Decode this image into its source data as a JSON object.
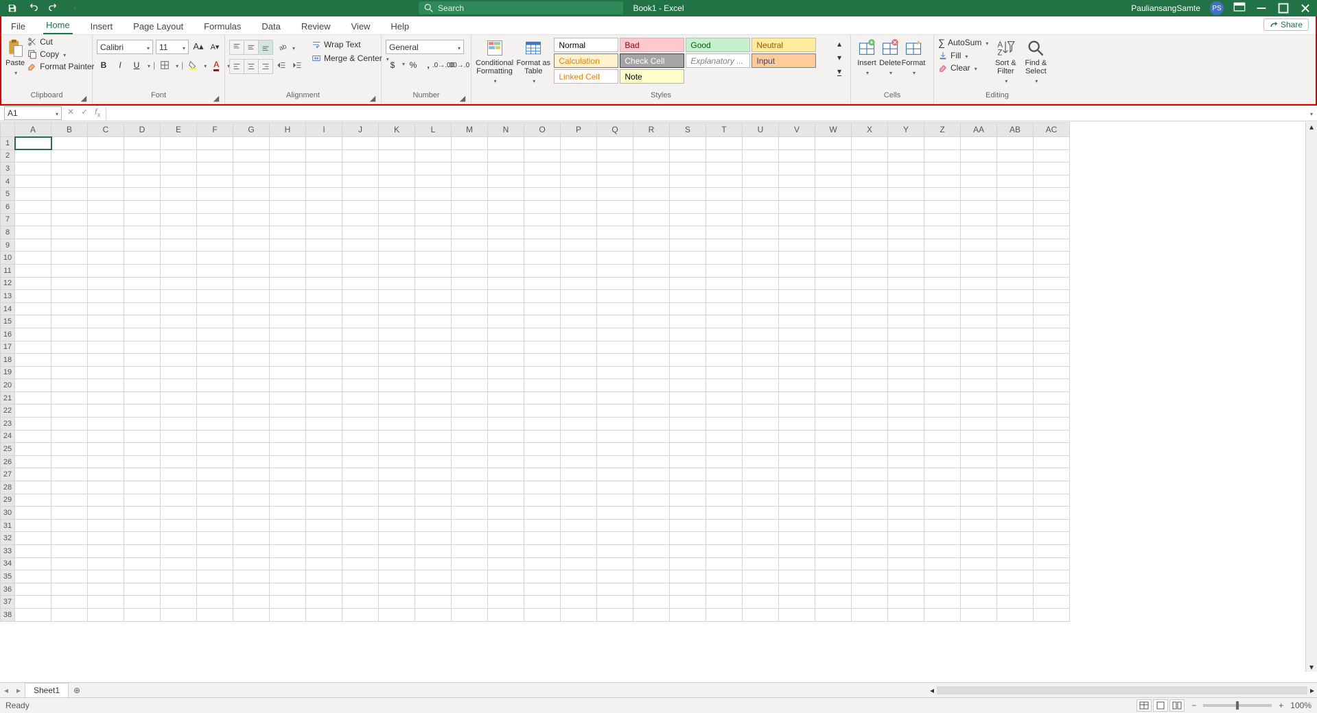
{
  "title_bar": {
    "doc_title": "Book1  -  Excel",
    "search_placeholder": "Search",
    "username": "PauliansangSamte",
    "avatar_initials": "PS"
  },
  "tabs": {
    "file": "File",
    "home": "Home",
    "insert": "Insert",
    "page_layout": "Page Layout",
    "formulas": "Formulas",
    "data": "Data",
    "review": "Review",
    "view": "View",
    "help": "Help",
    "share": "Share"
  },
  "ribbon": {
    "clipboard": {
      "paste": "Paste",
      "cut": "Cut",
      "copy": "Copy",
      "format_painter": "Format Painter",
      "label": "Clipboard"
    },
    "font": {
      "name": "Calibri",
      "size": "11",
      "label": "Font"
    },
    "alignment": {
      "wrap": "Wrap Text",
      "merge": "Merge & Center",
      "label": "Alignment"
    },
    "number": {
      "format": "General",
      "label": "Number"
    },
    "styles": {
      "cond": "Conditional Formatting",
      "fat": "Format as Table",
      "items": [
        {
          "label": "Normal",
          "bg": "#ffffff",
          "fg": "#000000"
        },
        {
          "label": "Bad",
          "bg": "#ffc7ce",
          "fg": "#9c0006"
        },
        {
          "label": "Good",
          "bg": "#c6efce",
          "fg": "#006100"
        },
        {
          "label": "Neutral",
          "bg": "#ffeb9c",
          "fg": "#9c5700"
        },
        {
          "label": "Calculation",
          "bg": "#fff2cc",
          "fg": "#fa7d00",
          "border": "#7f7f7f"
        },
        {
          "label": "Check Cell",
          "bg": "#a5a5a5",
          "fg": "#ffffff",
          "border": "#3f3f3f"
        },
        {
          "label": "Explanatory ...",
          "bg": "#ffffff",
          "fg": "#7f7f7f",
          "italic": true
        },
        {
          "label": "Input",
          "bg": "#ffcc99",
          "fg": "#3f3f76",
          "border": "#7f7f7f"
        },
        {
          "label": "Linked Cell",
          "bg": "#ffffff",
          "fg": "#fa7d00"
        },
        {
          "label": "Note",
          "bg": "#ffffcc",
          "fg": "#000000",
          "border": "#b2b2b2"
        }
      ],
      "label": "Styles"
    },
    "cells": {
      "insert": "Insert",
      "delete": "Delete",
      "format": "Format",
      "label": "Cells"
    },
    "editing": {
      "autosum": "AutoSum",
      "fill": "Fill",
      "clear": "Clear",
      "sort": "Sort & Filter",
      "find": "Find & Select",
      "label": "Editing"
    }
  },
  "formula_bar": {
    "name_box": "A1"
  },
  "grid": {
    "columns": [
      "A",
      "B",
      "C",
      "D",
      "E",
      "F",
      "G",
      "H",
      "I",
      "J",
      "K",
      "L",
      "M",
      "N",
      "O",
      "P",
      "Q",
      "R",
      "S",
      "T",
      "U",
      "V",
      "W",
      "X",
      "Y",
      "Z",
      "AA",
      "AB",
      "AC"
    ],
    "row_count": 38,
    "selected": "A1"
  },
  "sheet_tabs": {
    "sheet1": "Sheet1"
  },
  "status": {
    "ready": "Ready",
    "zoom": "100%"
  }
}
